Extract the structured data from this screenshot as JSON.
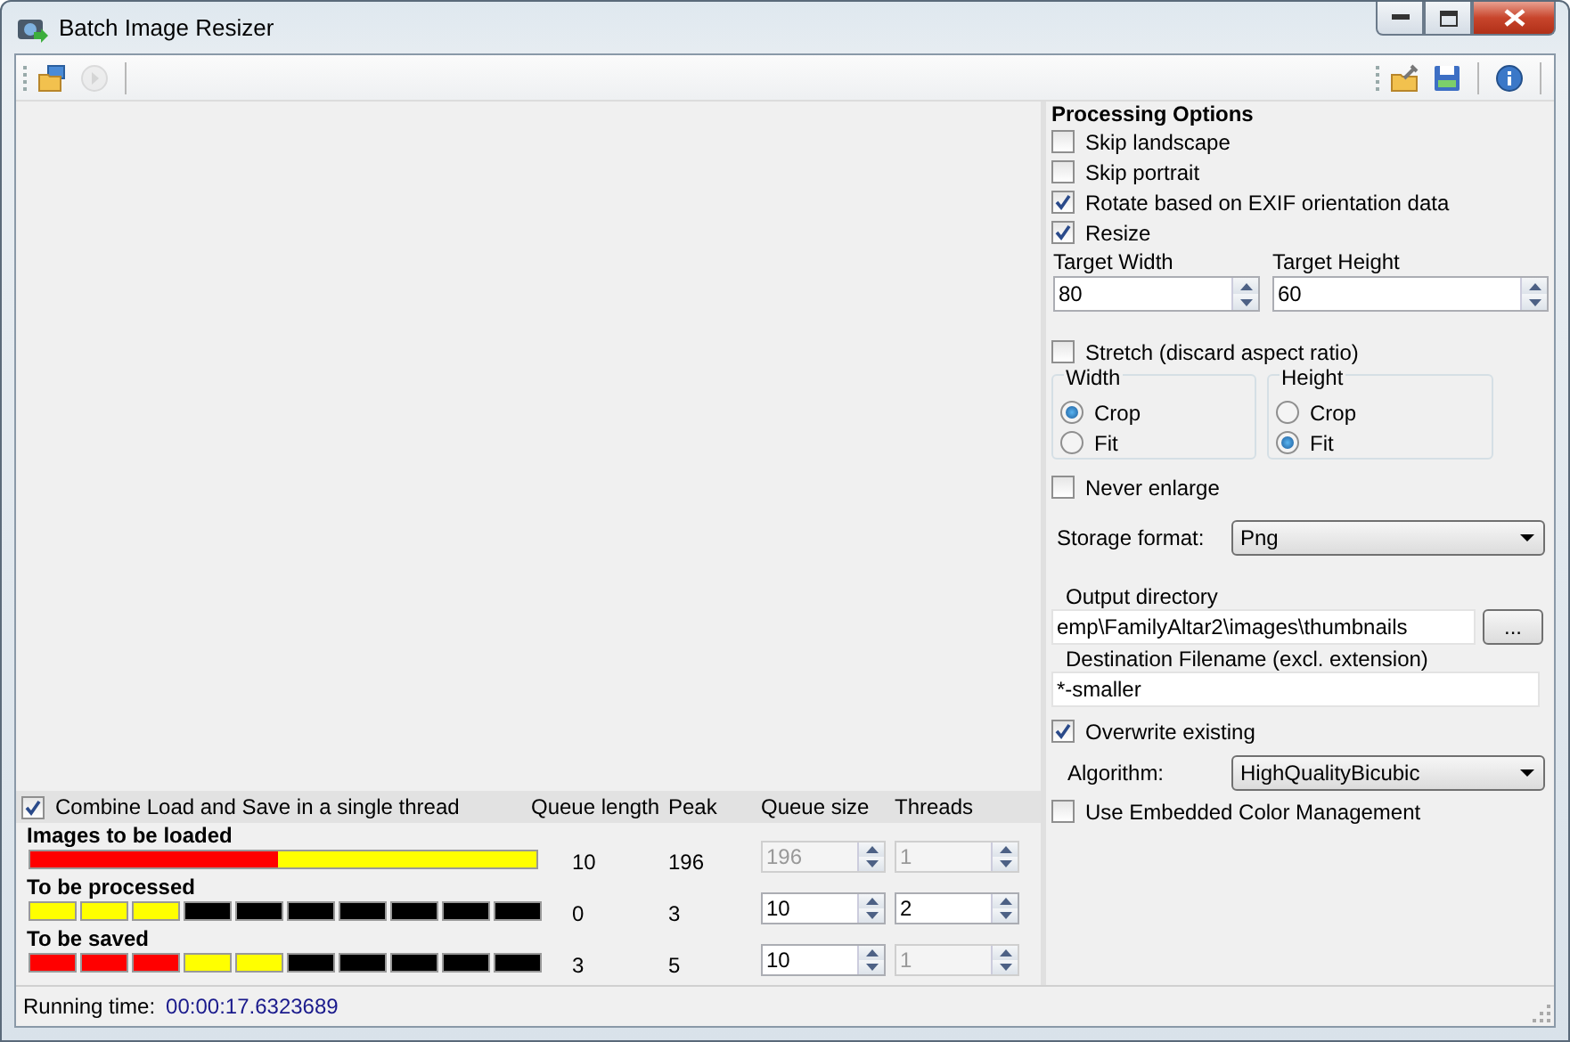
{
  "window": {
    "title": "Batch Image Resizer"
  },
  "toolbar": {
    "left": [
      {
        "kind": "open",
        "disabled": false
      },
      {
        "kind": "play",
        "disabled": true
      }
    ],
    "right": [
      {
        "kind": "settings-folder",
        "disabled": false
      },
      {
        "kind": "save",
        "disabled": false
      },
      {
        "kind": "info",
        "disabled": false
      }
    ]
  },
  "options": {
    "title": "Processing Options",
    "checkboxes": [
      {
        "label": "Skip landscape",
        "checked": false
      },
      {
        "label": "Skip portrait",
        "checked": false
      },
      {
        "label": "Rotate based on EXIF orientation data",
        "checked": true
      },
      {
        "label": "Resize",
        "checked": true
      }
    ],
    "target_width": {
      "label": "Target Width",
      "value": "80"
    },
    "target_height": {
      "label": "Target Height",
      "value": "60"
    },
    "stretch": {
      "label": "Stretch (discard aspect ratio)",
      "checked": false
    },
    "groups": [
      {
        "title": "Width",
        "radios": [
          {
            "label": "Crop",
            "selected": true
          },
          {
            "label": "Fit",
            "selected": false
          }
        ]
      },
      {
        "title": "Height",
        "radios": [
          {
            "label": "Crop",
            "selected": false
          },
          {
            "label": "Fit",
            "selected": true
          }
        ]
      }
    ],
    "never_enlarge": {
      "label": "Never enlarge",
      "checked": false
    },
    "storage_format": {
      "label": "Storage format:",
      "value": "Png"
    },
    "output_directory": {
      "label": "Output directory",
      "value": "emp\\FamilyAltar2\\images\\thumbnails",
      "button": "..."
    },
    "destination": {
      "label": "Destination Filename (excl. extension)",
      "value": "*-smaller"
    },
    "overwrite": {
      "label": "Overwrite existing",
      "checked": true
    },
    "algorithm": {
      "label": "Algorithm:",
      "value": "HighQualityBicubic"
    },
    "color_management": {
      "label": "Use Embedded Color Management",
      "checked": false
    }
  },
  "queues": {
    "combine": {
      "label": "Combine Load and Save in a single thread",
      "checked": true
    },
    "columns": [
      "Queue length",
      "Peak",
      "Queue size",
      "Threads"
    ],
    "rows": [
      {
        "name": "Images to be loaded",
        "kind": "continuous",
        "level": 0.49,
        "queue_length": "10",
        "peak": "196",
        "queue_size": {
          "value": "196",
          "disabled": true
        },
        "threads": {
          "value": "1",
          "disabled": true
        }
      },
      {
        "name": "To be processed",
        "kind": "segmented",
        "segments": [
          {
            "color": "#ffff00"
          },
          {
            "color": "#ffff00"
          },
          {
            "color": "#ffff00"
          },
          {
            "color": "#000000"
          },
          {
            "color": "#000000"
          },
          {
            "color": "#000000"
          },
          {
            "color": "#000000"
          },
          {
            "color": "#000000"
          },
          {
            "color": "#000000"
          },
          {
            "color": "#000000"
          }
        ],
        "queue_length": "0",
        "peak": "3",
        "queue_size": {
          "value": "10",
          "disabled": false
        },
        "threads": {
          "value": "2",
          "disabled": false
        }
      },
      {
        "name": "To be saved",
        "kind": "segmented",
        "segments": [
          {
            "color": "#ff0000"
          },
          {
            "color": "#ff0000"
          },
          {
            "color": "#ff0000"
          },
          {
            "color": "#ffff00"
          },
          {
            "color": "#ffff00"
          },
          {
            "color": "#000000"
          },
          {
            "color": "#000000"
          },
          {
            "color": "#000000"
          },
          {
            "color": "#000000"
          },
          {
            "color": "#000000"
          }
        ],
        "queue_length": "3",
        "peak": "5",
        "queue_size": {
          "value": "10",
          "disabled": false
        },
        "threads": {
          "value": "1",
          "disabled": true
        }
      }
    ]
  },
  "status_bar": {
    "label": "Running time:",
    "value": "00:00:17.6323689"
  }
}
